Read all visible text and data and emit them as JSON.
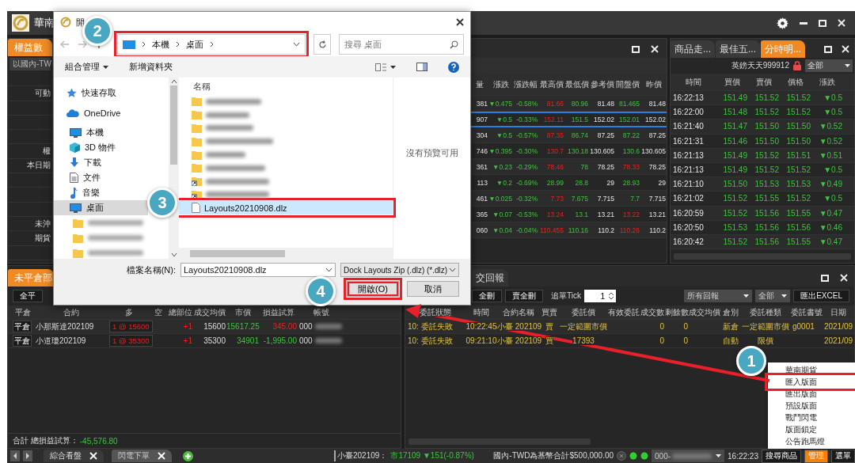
{
  "app_title": "華南",
  "equity": {
    "tab": "權益數",
    "currency": "以國內-TWI",
    "rows": [
      {},
      {
        "label": "可動"
      },
      {},
      {},
      {},
      {
        "label": "權"
      },
      {
        "label": "本日期"
      },
      {},
      {},
      {},
      {
        "label": "未沖"
      },
      {
        "label": "期貨"
      },
      {}
    ]
  },
  "quotes": {
    "columns": [
      "量",
      "漲跌",
      "漲跌幅",
      "最高價",
      "最低價",
      "參考價",
      "開盤價",
      "昨價"
    ],
    "rows": [
      {
        "selected": false,
        "high_up": true,
        "open_up": false,
        "cells": [
          "381",
          "▼0.475",
          "-0.58%",
          "81.66",
          "80.96",
          "81.48",
          "81.465",
          "81.48"
        ]
      },
      {
        "selected": true,
        "high_up": true,
        "open_up": false,
        "cells": [
          "907",
          "▼0.5",
          "-0.33%",
          "152.11",
          "151.5",
          "152.02",
          "152.01",
          "152.02"
        ]
      },
      {
        "selected": false,
        "high_up": true,
        "open_up": false,
        "cells": [
          "304",
          "▼0.5",
          "-0.57%",
          "87.35",
          "86.74",
          "87.25",
          "87.22",
          "87.25"
        ]
      },
      {
        "selected": false,
        "high_up": true,
        "open_up": false,
        "cells": [
          "746",
          "▼0.395",
          "-0.30%",
          "130.7",
          "130.18",
          "130.605",
          "130.6",
          "130.605"
        ]
      },
      {
        "selected": false,
        "high_up": true,
        "open_up": true,
        "cells": [
          "361",
          "▼0.23",
          "-0.29%",
          "78.46",
          "78",
          "78.25",
          "78.33",
          "78.25"
        ]
      },
      {
        "selected": false,
        "high_up": false,
        "open_up": false,
        "cells": [
          "113",
          "▼0.2",
          "-0.69%",
          "28.99",
          "28.8",
          "29",
          "28.93",
          "29"
        ]
      },
      {
        "selected": false,
        "high_up": true,
        "open_up": false,
        "cells": [
          "461",
          "▼0.025",
          "-0.32%",
          "7.73",
          "7.675",
          "7.715",
          "7.7",
          "7.715"
        ]
      },
      {
        "selected": false,
        "high_up": true,
        "open_up": true,
        "cells": [
          "365",
          "▼0.07",
          "-0.53%",
          "13.24",
          "13.1",
          "13.21",
          "13.22",
          "13.21"
        ]
      },
      {
        "selected": false,
        "high_up": true,
        "open_up": true,
        "cells": [
          "060",
          "▼0.04",
          "-0.04%",
          "110.455",
          "110.16",
          "110.2",
          "110.26",
          "110.2"
        ]
      }
    ]
  },
  "ticks": {
    "tabs": [
      {
        "label": "商品走...",
        "selected": false
      },
      {
        "label": "最佳五...",
        "selected": false
      },
      {
        "label": "分時明...",
        "selected": true
      }
    ],
    "symbol": "英鎊天天999912",
    "filter": "全部",
    "columns": [
      "時間",
      "買價",
      "賣價",
      "價格",
      "漲跌"
    ],
    "rows": [
      [
        "16:22:13",
        "151.49",
        "151.52",
        "151.52",
        "▼0.5"
      ],
      [
        "16:22:00",
        "151.48",
        "151.52",
        "151.52",
        "▼0.5"
      ],
      [
        "16:21:40",
        "151.47",
        "151.50",
        "151.50",
        "▼0.52"
      ],
      [
        "16:21:31",
        "151.46",
        "151.50",
        "151.50",
        "▼0.52"
      ],
      [
        "16:21:13",
        "151.49",
        "151.52",
        "151.51",
        "▼0.51"
      ],
      [
        "16:21:13",
        "151.49",
        "151.52",
        "151.52",
        "▼0.5"
      ],
      [
        "16:21:10",
        "151.50",
        "151.53",
        "151.53",
        "▼0.49"
      ],
      [
        "16:21:02",
        "151.52",
        "151.55",
        "151.52",
        "▼0.5"
      ],
      [
        "16:20:59",
        "151.52",
        "151.56",
        "151.55",
        "▼0.47"
      ],
      [
        "16:20:50",
        "151.53",
        "151.56",
        "151.56",
        "▼0.46"
      ],
      [
        "16:20:42",
        "151.52",
        "151.56",
        "151.55",
        "▼0.47"
      ]
    ]
  },
  "positions": {
    "tab": "未平倉部",
    "buttons": [
      "全平"
    ],
    "columns": [
      "平倉",
      "合約",
      "多",
      "空",
      "總部位",
      "成交均價",
      "市價",
      "損益試算",
      "帳號"
    ],
    "rows": [
      {
        "action": "平倉",
        "contract": "小那斯達202109",
        "long": "1 @ 15600",
        "net": "+1",
        "avg": "15600",
        "market": "15617.25",
        "market_up": false,
        "pnl": "345.00",
        "pnl_up": true,
        "account": "000"
      },
      {
        "action": "平倉",
        "contract": "小道瓊202109",
        "long": "1 @ 35300",
        "net": "+1",
        "avg": "35300",
        "market": "34901",
        "market_up": false,
        "pnl": "-1,995.00",
        "pnl_up": false,
        "account": "000"
      }
    ],
    "total_label": "合計 總損益試算：",
    "total": "-45,576.80",
    "total_up": false
  },
  "orders": {
    "tab": "交回報",
    "buttons": [
      "全刪",
      "賣全刪"
    ],
    "tick_label": "追單Tick",
    "tick_value": "1",
    "report_filter": "所有回報",
    "side_filter": "全部",
    "export": "匯出EXCEL",
    "columns": [
      "委託狀態",
      "時間",
      "合約名稱",
      "買賣",
      "委託價",
      "有效委託",
      "成交數",
      "剩餘數",
      "成交均價",
      "倉別",
      "委託種類",
      "委託書號",
      "日期"
    ],
    "rows": [
      {
        "status": "10: 委託失敗",
        "time": "10:22:45",
        "contract": "小臺 202109",
        "side": "賣",
        "price": "一定範圍市價",
        "filled": "0",
        "remaining": "0",
        "position": "新倉",
        "type": "一定範圍市價",
        "order_no": "g0001",
        "date": "2021/09"
      },
      {
        "status": "10: 委託失敗",
        "time": "09:21:10",
        "contract": "小臺 202109",
        "side": "買",
        "price": "17393",
        "filled": "0",
        "remaining": "0",
        "position": "自動",
        "type": "限價",
        "date": "2021/09"
      }
    ]
  },
  "menu": {
    "items": [
      {
        "label": "華南期貨",
        "highlighted": false
      },
      {
        "label": "匯入版面",
        "highlighted": true
      },
      {
        "label": "匯出版面",
        "highlighted": false
      },
      {
        "label": "預設版面",
        "highlighted": false
      },
      {
        "label": "戰鬥閃電",
        "highlighted": false
      },
      {
        "label": "版面鎖定",
        "highlighted": false
      },
      {
        "label": "公告跑馬燈",
        "highlighted": false
      }
    ]
  },
  "status_bar": {
    "tabs": [
      {
        "label": "綜合看盤",
        "selected": true
      },
      {
        "label": "閃電下單",
        "selected": false
      }
    ],
    "symbol": "小臺202109：",
    "quote": "市17109 ▼151(-0.87%)",
    "balance": "國內-TWD為基幣合計$500,000.00",
    "account": "000-",
    "time": "16:22:23",
    "buttons": [
      {
        "label": "搜尋商品",
        "selected": false
      },
      {
        "label": "管理",
        "selected": true
      },
      {
        "label": "選單",
        "selected": false
      }
    ]
  },
  "dialog": {
    "title": "開",
    "path": [
      "本機",
      "桌面"
    ],
    "path_highlighted": true,
    "search_placeholder": "搜尋 桌面",
    "toolbar": [
      "組合管理",
      "新增資料夾"
    ],
    "nav": [
      {
        "kind": "quick-access",
        "label": "快速存取",
        "selected": false
      },
      {
        "kind": "cloud",
        "label": "OneDrive",
        "selected": false
      },
      {
        "kind": "pc",
        "label": "本機",
        "selected": false
      },
      {
        "kind": "objects",
        "label": "3D 物件",
        "selected": false
      },
      {
        "kind": "downloads",
        "label": "下載",
        "selected": false
      },
      {
        "kind": "documents",
        "label": "文件",
        "selected": false
      },
      {
        "kind": "music",
        "label": "音樂",
        "selected": false
      },
      {
        "kind": "desktop",
        "label": "桌面",
        "selected": true
      },
      {
        "kind": "folder",
        "selected": false
      },
      {
        "kind": "folder",
        "selected": false
      },
      {
        "kind": "folder",
        "selected": false
      }
    ],
    "column": "名稱",
    "files": [
      {
        "kind": "folder",
        "selected": false
      },
      {
        "kind": "folder",
        "selected": false
      },
      {
        "kind": "folder",
        "selected": false
      },
      {
        "kind": "folder",
        "selected": false
      },
      {
        "kind": "folder",
        "selected": false
      },
      {
        "kind": "folder",
        "selected": false
      },
      {
        "kind": "shortcut",
        "selected": false
      },
      {
        "kind": "shortcut",
        "selected": false
      },
      {
        "kind": "file",
        "name": "Layouts20210908.dlz",
        "selected": true,
        "highlighted": true
      }
    ],
    "preview": "沒有預覽可用",
    "filename_label": "檔案名稱(N):",
    "filename": "Layouts20210908.dlz",
    "filetype": "Dock Layouts Zip (.dlz) (*.dlz)",
    "buttons": [
      {
        "label": "開啟(O)",
        "highlighted": true
      },
      {
        "label": "取消",
        "highlighted": false
      }
    ]
  },
  "callouts": [
    "1",
    "2",
    "3",
    "4"
  ]
}
